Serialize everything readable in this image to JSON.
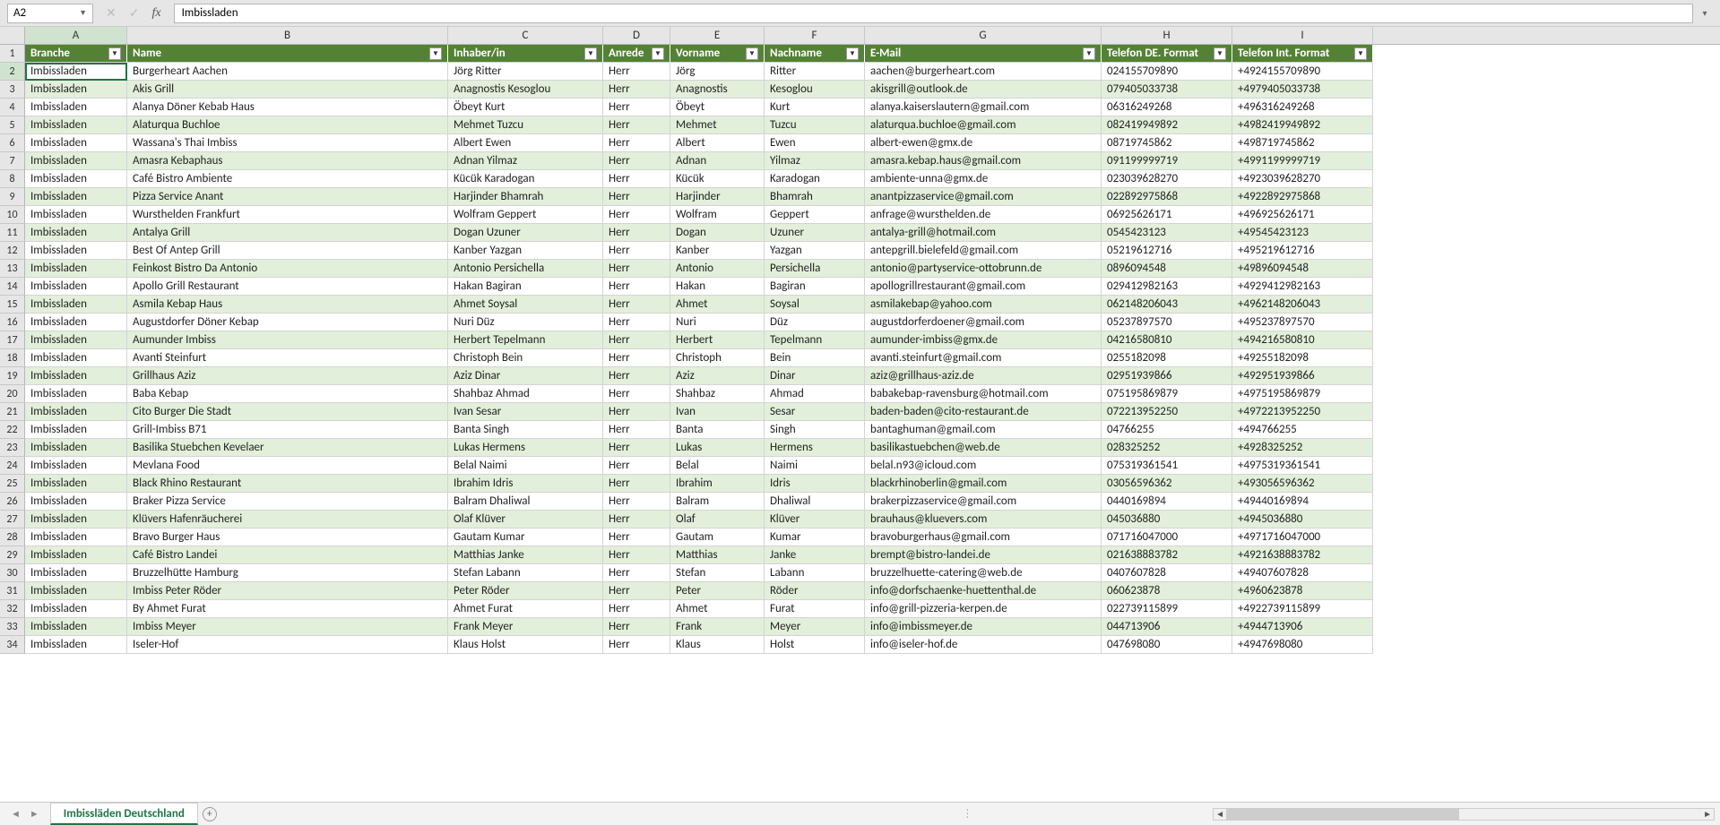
{
  "nameBox": "A2",
  "formulaValue": "Imbissladen",
  "columns": [
    "A",
    "B",
    "C",
    "D",
    "E",
    "F",
    "G",
    "H",
    "I"
  ],
  "headers": [
    "Branche",
    "Name",
    "Inhaber/in",
    "Anrede",
    "Vorname",
    "Nachname",
    "E-Mail",
    "Telefon DE. Format",
    "Telefon Int. Format"
  ],
  "sheetTab": "Imbissläden Deutschland",
  "activeCell": {
    "row": 2,
    "col": 0
  },
  "rows": [
    {
      "n": 2,
      "d": [
        "Imbissladen",
        "Burgerheart Aachen",
        "Jörg Ritter",
        "Herr",
        "Jörg",
        "Ritter",
        "aachen@burgerheart.com",
        "024155709890",
        "+4924155709890"
      ]
    },
    {
      "n": 3,
      "d": [
        "Imbissladen",
        "Akis Grill",
        "Anagnostis Kesoglou",
        "Herr",
        "Anagnostis",
        "Kesoglou",
        "akisgrill@outlook.de",
        "079405033738",
        "+4979405033738"
      ]
    },
    {
      "n": 4,
      "d": [
        "Imbissladen",
        "Alanya Döner Kebab Haus",
        "Öbeyt Kurt",
        "Herr",
        "Öbeyt",
        "Kurt",
        "alanya.kaiserslautern@gmail.com",
        "06316249268",
        "+496316249268"
      ]
    },
    {
      "n": 5,
      "d": [
        "Imbissladen",
        "Alaturqua Buchloe",
        "Mehmet Tuzcu",
        "Herr",
        "Mehmet",
        "Tuzcu",
        "alaturqua.buchloe@gmail.com",
        "082419949892",
        "+4982419949892"
      ]
    },
    {
      "n": 6,
      "d": [
        "Imbissladen",
        "Wassana's Thai Imbiss",
        "Albert Ewen",
        "Herr",
        "Albert",
        "Ewen",
        "albert-ewen@gmx.de",
        "08719745862",
        "+498719745862"
      ]
    },
    {
      "n": 7,
      "d": [
        "Imbissladen",
        "Amasra Kebaphaus",
        "Adnan Yilmaz",
        "Herr",
        "Adnan",
        "Yilmaz",
        "amasra.kebap.haus@gmail.com",
        "091199999719",
        "+4991199999719"
      ]
    },
    {
      "n": 8,
      "d": [
        "Imbissladen",
        "Café Bistro Ambiente",
        "Kücük Karadogan",
        "Herr",
        "Kücük",
        "Karadogan",
        "ambiente-unna@gmx.de",
        "023039628270",
        "+4923039628270"
      ]
    },
    {
      "n": 9,
      "d": [
        "Imbissladen",
        "Pizza Service Anant",
        "Harjinder Bhamrah",
        "Herr",
        "Harjinder",
        "Bhamrah",
        "anantpizzaservice@gmail.com",
        "022892975868",
        "+4922892975868"
      ]
    },
    {
      "n": 10,
      "d": [
        "Imbissladen",
        "Wursthelden Frankfurt",
        "Wolfram Geppert",
        "Herr",
        "Wolfram",
        "Geppert",
        "anfrage@wursthelden.de",
        "06925626171",
        "+496925626171"
      ]
    },
    {
      "n": 11,
      "d": [
        "Imbissladen",
        "Antalya Grill",
        "Dogan Uzuner",
        "Herr",
        "Dogan",
        "Uzuner",
        "antalya-grill@hotmail.com",
        "0545423123",
        "+49545423123"
      ]
    },
    {
      "n": 12,
      "d": [
        "Imbissladen",
        "Best Of Antep Grill",
        "Kanber Yazgan",
        "Herr",
        "Kanber",
        "Yazgan",
        "antepgrill.bielefeld@gmail.com",
        "05219612716",
        "+495219612716"
      ]
    },
    {
      "n": 13,
      "d": [
        "Imbissladen",
        "Feinkost Bistro Da Antonio",
        "Antonio Persichella",
        "Herr",
        "Antonio",
        "Persichella",
        "antonio@partyservice-ottobrunn.de",
        "0896094548",
        "+49896094548"
      ]
    },
    {
      "n": 14,
      "d": [
        "Imbissladen",
        "Apollo Grill Restaurant",
        "Hakan Bagiran",
        "Herr",
        "Hakan",
        "Bagiran",
        "apollogrillrestaurant@gmail.com",
        "029412982163",
        "+4929412982163"
      ]
    },
    {
      "n": 15,
      "d": [
        "Imbissladen",
        "Asmila Kebap Haus",
        "Ahmet Soysal",
        "Herr",
        "Ahmet",
        "Soysal",
        "asmilakebap@yahoo.com",
        "062148206043",
        "+4962148206043"
      ]
    },
    {
      "n": 16,
      "d": [
        "Imbissladen",
        "Augustdorfer Döner Kebap",
        "Nuri Düz",
        "Herr",
        "Nuri",
        "Düz",
        "augustdorferdoener@gmail.com",
        "05237897570",
        "+495237897570"
      ]
    },
    {
      "n": 17,
      "d": [
        "Imbissladen",
        "Aumunder Imbiss",
        "Herbert Tepelmann",
        "Herr",
        "Herbert",
        "Tepelmann",
        "aumunder-imbiss@gmx.de",
        "04216580810",
        "+494216580810"
      ]
    },
    {
      "n": 18,
      "d": [
        "Imbissladen",
        "Avanti Steinfurt",
        "Christoph Bein",
        "Herr",
        "Christoph",
        "Bein",
        "avanti.steinfurt@gmail.com",
        "0255182098",
        "+49255182098"
      ]
    },
    {
      "n": 19,
      "d": [
        "Imbissladen",
        "Grillhaus Aziz",
        "Aziz Dinar",
        "Herr",
        "Aziz",
        "Dinar",
        "aziz@grillhaus-aziz.de",
        "02951939866",
        "+492951939866"
      ]
    },
    {
      "n": 20,
      "d": [
        "Imbissladen",
        "Baba Kebap",
        "Shahbaz Ahmad",
        "Herr",
        "Shahbaz",
        "Ahmad",
        "babakebap-ravensburg@hotmail.com",
        "075195869879",
        "+4975195869879"
      ]
    },
    {
      "n": 21,
      "d": [
        "Imbissladen",
        "Cito Burger Die Stadt",
        "Ivan Sesar",
        "Herr",
        "Ivan",
        "Sesar",
        "baden-baden@cito-restaurant.de",
        "072213952250",
        "+4972213952250"
      ]
    },
    {
      "n": 22,
      "d": [
        "Imbissladen",
        "Grill-Imbiss B71",
        "Banta Singh",
        "Herr",
        "Banta",
        "Singh",
        "bantaghuman@gmail.com",
        "04766255",
        "+494766255"
      ]
    },
    {
      "n": 23,
      "d": [
        "Imbissladen",
        "Basilika Stuebchen Kevelaer",
        "Lukas Hermens",
        "Herr",
        "Lukas",
        "Hermens",
        "basilikastuebchen@web.de",
        "028325252",
        "+4928325252"
      ]
    },
    {
      "n": 24,
      "d": [
        "Imbissladen",
        "Mevlana Food",
        "Belal Naimi",
        "Herr",
        "Belal",
        "Naimi",
        "belal.n93@icloud.com",
        "075319361541",
        "+4975319361541"
      ]
    },
    {
      "n": 25,
      "d": [
        "Imbissladen",
        "Black Rhino Restaurant",
        "Ibrahim Idris",
        "Herr",
        "Ibrahim",
        "Idris",
        "blackrhinoberlin@gmail.com",
        "03056596362",
        "+493056596362"
      ]
    },
    {
      "n": 26,
      "d": [
        "Imbissladen",
        "Braker Pizza Service",
        "Balram Dhaliwal",
        "Herr",
        "Balram",
        "Dhaliwal",
        "brakerpizzaservice@gmail.com",
        "0440169894",
        "+49440169894"
      ]
    },
    {
      "n": 27,
      "d": [
        "Imbissladen",
        "Klüvers Hafenräucherei",
        "Olaf Klüver",
        "Herr",
        "Olaf",
        "Klüver",
        "brauhaus@kluevers.com",
        "045036880",
        "+4945036880"
      ]
    },
    {
      "n": 28,
      "d": [
        "Imbissladen",
        "Bravo Burger Haus",
        "Gautam Kumar",
        "Herr",
        "Gautam",
        "Kumar",
        "bravoburgerhaus@gmail.com",
        "071716047000",
        "+4971716047000"
      ]
    },
    {
      "n": 29,
      "d": [
        "Imbissladen",
        "Café Bistro Landei",
        "Matthias Janke",
        "Herr",
        "Matthias",
        "Janke",
        "brempt@bistro-landei.de",
        "021638883782",
        "+4921638883782"
      ]
    },
    {
      "n": 30,
      "d": [
        "Imbissladen",
        "Bruzzelhütte Hamburg",
        "Stefan Labann",
        "Herr",
        "Stefan",
        "Labann",
        "bruzzelhuette-catering@web.de",
        "0407607828",
        "+49407607828"
      ]
    },
    {
      "n": 31,
      "d": [
        "Imbissladen",
        "Imbiss Peter Röder",
        "Peter Röder",
        "Herr",
        "Peter",
        "Röder",
        "info@dorfschaenke-huettenthal.de",
        "060623878",
        "+4960623878"
      ]
    },
    {
      "n": 32,
      "d": [
        "Imbissladen",
        "By Ahmet Furat",
        "Ahmet Furat",
        "Herr",
        "Ahmet",
        "Furat",
        "info@grill-pizzeria-kerpen.de",
        "022739115899",
        "+4922739115899"
      ]
    },
    {
      "n": 33,
      "d": [
        "Imbissladen",
        "Imbiss Meyer",
        "Frank Meyer",
        "Herr",
        "Frank",
        "Meyer",
        "info@imbissmeyer.de",
        "044713906",
        "+4944713906"
      ]
    },
    {
      "n": 34,
      "d": [
        "Imbissladen",
        "Iseler-Hof",
        "Klaus Holst",
        "Herr",
        "Klaus",
        "Holst",
        "info@iseler-hof.de",
        "047698080",
        "+4947698080"
      ]
    }
  ]
}
